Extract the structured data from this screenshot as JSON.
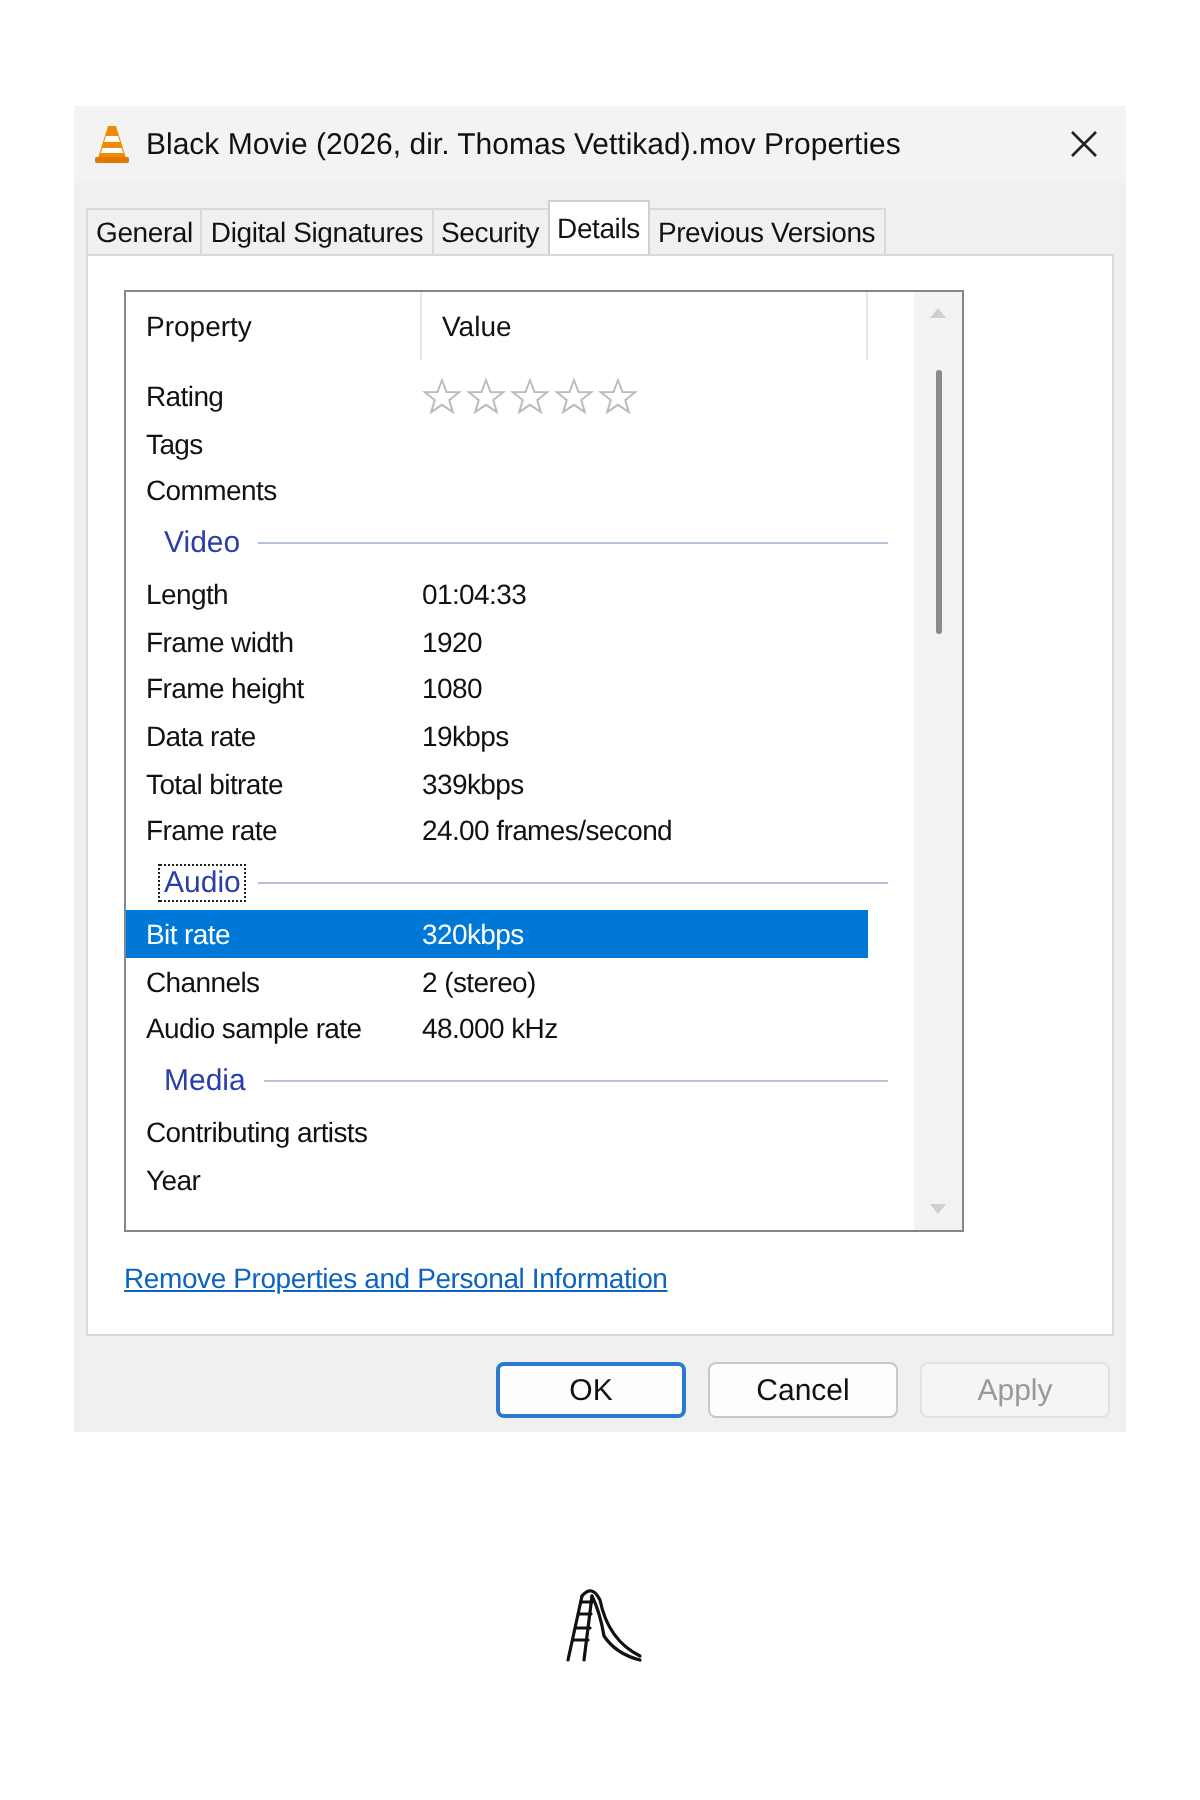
{
  "window": {
    "title": "Black Movie (2026, dir. Thomas Vettikad).mov Properties"
  },
  "tabs": [
    {
      "label": "General",
      "selected": false
    },
    {
      "label": "Digital Signatures",
      "selected": false
    },
    {
      "label": "Security",
      "selected": false
    },
    {
      "label": "Details",
      "selected": true
    },
    {
      "label": "Previous Versions",
      "selected": false
    }
  ],
  "table": {
    "columns": [
      "Property",
      "Value"
    ],
    "rows": [
      {
        "kind": "rating",
        "name": "Rating",
        "stars": 0,
        "selected": false
      },
      {
        "kind": "property",
        "name": "Tags",
        "value": "",
        "selected": false
      },
      {
        "kind": "property",
        "name": "Comments",
        "value": "",
        "selected": false
      },
      {
        "kind": "group",
        "name": "Video",
        "focused": false
      },
      {
        "kind": "property",
        "name": "Length",
        "value": "01:04:33",
        "selected": false
      },
      {
        "kind": "property",
        "name": "Frame width",
        "value": "1920",
        "selected": false
      },
      {
        "kind": "property",
        "name": "Frame height",
        "value": "1080",
        "selected": false
      },
      {
        "kind": "property",
        "name": "Data rate",
        "value": "19kbps",
        "selected": false
      },
      {
        "kind": "property",
        "name": "Total bitrate",
        "value": "339kbps",
        "selected": false
      },
      {
        "kind": "property",
        "name": "Frame rate",
        "value": "24.00 frames/second",
        "selected": false
      },
      {
        "kind": "group",
        "name": "Audio",
        "focused": true
      },
      {
        "kind": "property",
        "name": "Bit rate",
        "value": "320kbps",
        "selected": true
      },
      {
        "kind": "property",
        "name": "Channels",
        "value": "2 (stereo)",
        "selected": false
      },
      {
        "kind": "property",
        "name": "Audio sample rate",
        "value": "48.000 kHz",
        "selected": false
      },
      {
        "kind": "group",
        "name": "Media",
        "focused": false
      },
      {
        "kind": "property",
        "name": "Contributing artists",
        "value": "",
        "selected": false
      },
      {
        "kind": "property",
        "name": "Year",
        "value": "",
        "selected": false
      }
    ]
  },
  "link": "Remove Properties and Personal Information",
  "buttons": [
    {
      "label": "OK",
      "kind": "default",
      "disabled": false
    },
    {
      "label": "Cancel",
      "kind": "normal",
      "disabled": false
    },
    {
      "label": "Apply",
      "kind": "normal",
      "disabled": true
    }
  ]
}
